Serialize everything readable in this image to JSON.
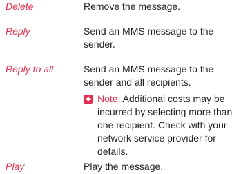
{
  "entries": [
    {
      "term": "Delete",
      "description": "Remove the message."
    },
    {
      "term": "Reply",
      "description": "Send an MMS message to the sender."
    },
    {
      "term": "Reply to all",
      "description": "Send an MMS message to the sender and all recipients."
    },
    {
      "term": "Play",
      "description": "Play the message."
    }
  ],
  "note": {
    "label": "Note:",
    "text": " Additional costs may be incurred by selecting more than one recipient. Check with your network service provider for details.",
    "icon": "arrow-right-icon"
  },
  "colors": {
    "accent": "#e2304f",
    "text": "#231f20"
  }
}
